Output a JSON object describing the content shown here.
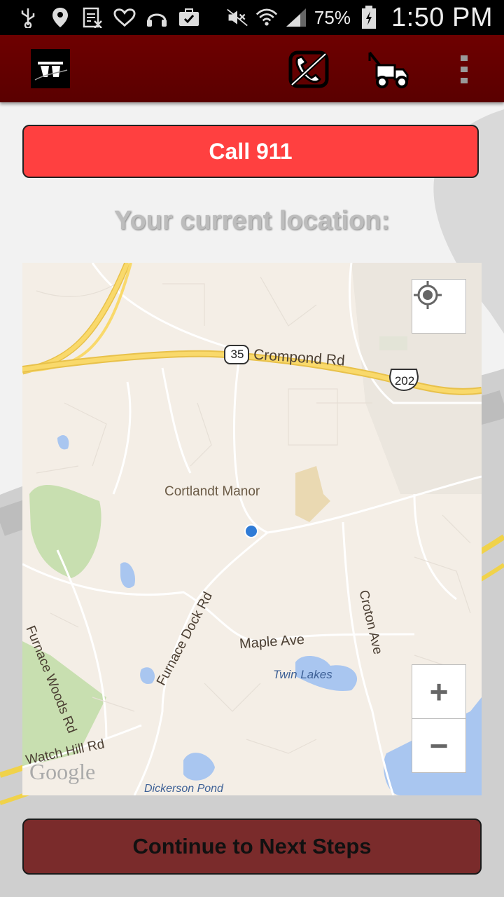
{
  "status_bar": {
    "battery_percent": "75%",
    "time": "1:50 PM",
    "icons": [
      "usb-icon",
      "location-pin-icon",
      "sim-off-icon",
      "iheart-icon",
      "headphones-icon",
      "briefcase-check-icon",
      "mute-icon",
      "wifi-icon",
      "signal-icon",
      "battery-charging-icon"
    ]
  },
  "action_bar": {
    "icons": [
      "app-logo",
      "call-hangup-icon",
      "tow-truck-icon",
      "overflow-menu-icon"
    ]
  },
  "call_button_label": "Call 911",
  "location_title": "Your current location:",
  "map": {
    "labels": {
      "road_crompond": "Crompond Rd",
      "shield_35": "35",
      "shield_202": "202",
      "place_cortlandt": "Cortlandt Manor",
      "road_furnace_woods": "Furnace Woods Rd",
      "road_furnace_dock": "Furnace Dock Rd",
      "road_maple": "Maple Ave",
      "road_croton": "Croton Ave",
      "water_twin_lakes": "Twin Lakes",
      "road_watch_hill": "Watch Hill Rd",
      "water_dickerson": "Dickerson Pond",
      "attribution": "Google"
    },
    "zoom_in": "+",
    "zoom_out": "−"
  },
  "continue_button_label": "Continue to Next Steps",
  "colors": {
    "action_bar": "#6e0000",
    "call_button": "#ff4040",
    "continue_button": "#7a2b2b"
  }
}
